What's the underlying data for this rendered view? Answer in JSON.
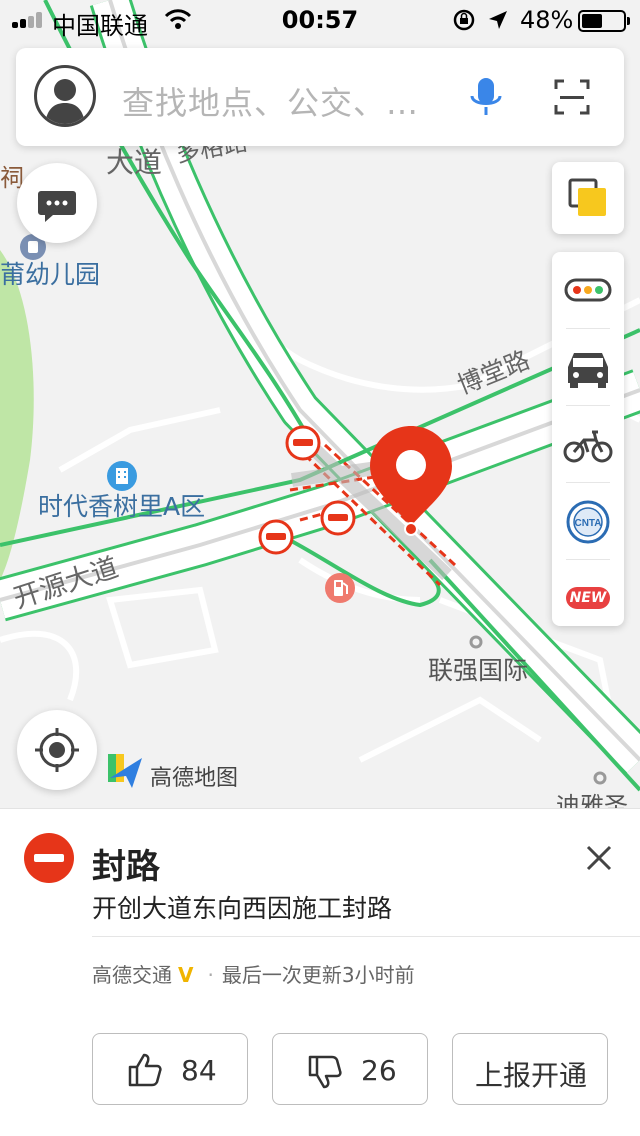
{
  "status_bar": {
    "carrier": "中国联通",
    "time": "00:57",
    "battery_percent": "48%"
  },
  "search": {
    "placeholder": "查找地点、公交、…",
    "icons": [
      "avatar-icon",
      "microphone-icon",
      "scan-icon"
    ]
  },
  "map": {
    "labels": {
      "road_main_ne": "大道",
      "road_duoge": "多格路",
      "road_botang": "博堂路",
      "road_kaiyuan": "开源大道",
      "poi_kindergarten": "莆幼儿园",
      "poi_edge_char": "祠",
      "poi_shidai": "时代香树里A区",
      "poi_lianqiang": "联强国际",
      "poi_bottom_right": "迪雅圣"
    },
    "brand_text": "高德地图",
    "colors": {
      "road_outline": "#3cc26a",
      "closure_red": "#e63519",
      "tool_new": "#e84040"
    },
    "closure_markers": 3
  },
  "side_tools": {
    "layers": "layers-icon",
    "items": [
      "traffic-icon",
      "taxi-icon",
      "bike-icon",
      "cnta-icon",
      "new-badge"
    ],
    "new_label": "NEW",
    "cnta_label": "CNTA"
  },
  "panel": {
    "title": "封路",
    "description": "开创大道东向西因施工封路",
    "source": "高德交通",
    "verified_mark": "V",
    "updated": "最后一次更新3小时前",
    "like_count": "84",
    "dislike_count": "26",
    "report_label": "上报开通"
  }
}
